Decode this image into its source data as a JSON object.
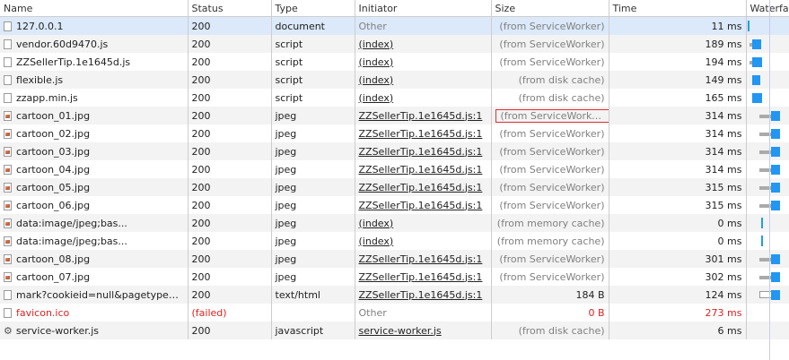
{
  "columns": {
    "name": "Name",
    "status": "Status",
    "type": "Type",
    "initiator": "Initiator",
    "size": "Size",
    "time": "Time",
    "waterfall": "Waterfall"
  },
  "rows": [
    {
      "name": "127.0.0.1",
      "icon": "document-icon",
      "status": "200",
      "type": "document",
      "initiator": "Other",
      "size": "(from ServiceWorker)",
      "time": "11 ms"
    },
    {
      "name": "vendor.60d9470.js",
      "icon": "document-icon",
      "status": "200",
      "type": "script",
      "initiator": "(index)",
      "size": "(from ServiceWorker)",
      "time": "189 ms"
    },
    {
      "name": "ZZSellerTip.1e1645d.js",
      "icon": "document-icon",
      "status": "200",
      "type": "script",
      "initiator": "(index)",
      "size": "(from ServiceWorker)",
      "time": "194 ms"
    },
    {
      "name": "flexible.js",
      "icon": "document-icon",
      "status": "200",
      "type": "script",
      "initiator": "(index)",
      "size": "(from disk cache)",
      "time": "149 ms"
    },
    {
      "name": "zzapp.min.js",
      "icon": "document-icon",
      "status": "200",
      "type": "script",
      "initiator": "(index)",
      "size": "(from disk cache)",
      "time": "165 ms"
    },
    {
      "name": "cartoon_01.jpg",
      "icon": "image-icon",
      "status": "200",
      "type": "jpeg",
      "initiator": "ZZSellerTip.1e1645d.js:1",
      "size": "(from ServiceWorker)",
      "time": "314 ms"
    },
    {
      "name": "cartoon_02.jpg",
      "icon": "image-icon",
      "status": "200",
      "type": "jpeg",
      "initiator": "ZZSellerTip.1e1645d.js:1",
      "size": "(from ServiceWorker)",
      "time": "314 ms"
    },
    {
      "name": "cartoon_03.jpg",
      "icon": "image-icon",
      "status": "200",
      "type": "jpeg",
      "initiator": "ZZSellerTip.1e1645d.js:1",
      "size": "(from ServiceWorker)",
      "time": "314 ms"
    },
    {
      "name": "cartoon_04.jpg",
      "icon": "image-icon",
      "status": "200",
      "type": "jpeg",
      "initiator": "ZZSellerTip.1e1645d.js:1",
      "size": "(from ServiceWorker)",
      "time": "314 ms"
    },
    {
      "name": "cartoon_05.jpg",
      "icon": "image-icon",
      "status": "200",
      "type": "jpeg",
      "initiator": "ZZSellerTip.1e1645d.js:1",
      "size": "(from ServiceWorker)",
      "time": "315 ms"
    },
    {
      "name": "cartoon_06.jpg",
      "icon": "image-icon",
      "status": "200",
      "type": "jpeg",
      "initiator": "ZZSellerTip.1e1645d.js:1",
      "size": "(from ServiceWorker)",
      "time": "315 ms"
    },
    {
      "name": "data:image/jpeg;bas...",
      "icon": "image-icon",
      "status": "200",
      "type": "jpeg",
      "initiator": "(index)",
      "size": "(from memory cache)",
      "time": "0 ms"
    },
    {
      "name": "data:image/jpeg;bas...",
      "icon": "image-icon",
      "status": "200",
      "type": "jpeg",
      "initiator": "(index)",
      "size": "(from memory cache)",
      "time": "0 ms"
    },
    {
      "name": "cartoon_08.jpg",
      "icon": "image-icon",
      "status": "200",
      "type": "jpeg",
      "initiator": "ZZSellerTip.1e1645d.js:1",
      "size": "(from ServiceWorker)",
      "time": "301 ms"
    },
    {
      "name": "cartoon_07.jpg",
      "icon": "image-icon",
      "status": "200",
      "type": "jpeg",
      "initiator": "ZZSellerTip.1e1645d.js:1",
      "size": "(from ServiceWorker)",
      "time": "302 ms"
    },
    {
      "name": "mark?cookieid=null&pagetype=...",
      "icon": "document-icon",
      "status": "200",
      "type": "text/html",
      "initiator": "ZZSellerTip.1e1645d.js:1",
      "size": "184 B",
      "time": "124 ms"
    },
    {
      "name": "favicon.ico",
      "icon": "document-icon",
      "status": "(failed)",
      "type": "",
      "initiator": "Other",
      "size": "0 B",
      "time": "273 ms"
    },
    {
      "name": "service-worker.js",
      "icon": "gear-icon",
      "status": "200",
      "type": "javascript",
      "initiator": "service-worker.js",
      "size": "(from disk cache)",
      "time": "6 ms"
    }
  ],
  "gear_glyph": "⚙",
  "colors": {
    "selected_row": "#dbe9fa",
    "failed_text": "#dd2222",
    "waterfall_bar": "#2196f3",
    "highlight_border": "#e03030"
  }
}
